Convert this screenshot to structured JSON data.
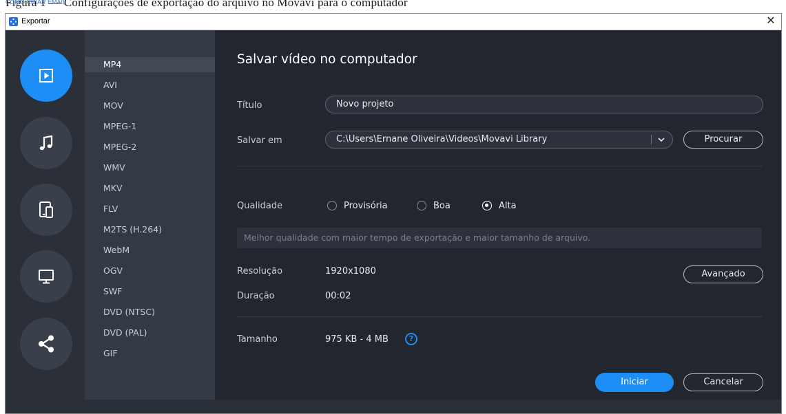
{
  "background": {
    "doc_text": "Figura 1 — Configurações de exportação do arquivo no Movavi para o computador",
    "link_text": "COMO CRIAR EMAIL"
  },
  "window": {
    "title": "Exportar",
    "close_glyph": "✕"
  },
  "colors": {
    "accent": "#1e8ef7",
    "window_bg": "#2a2f38",
    "panel_bg": "#22262e"
  },
  "rail": [
    {
      "id": "video",
      "icon": "play-icon",
      "active": true
    },
    {
      "id": "audio",
      "icon": "music-note-icon",
      "active": false
    },
    {
      "id": "devices",
      "icon": "devices-icon",
      "active": false
    },
    {
      "id": "tv",
      "icon": "monitor-icon",
      "active": false
    },
    {
      "id": "share",
      "icon": "share-icon",
      "active": false
    }
  ],
  "formats": {
    "selected": "MP4",
    "items": [
      "MP4",
      "AVI",
      "MOV",
      "MPEG-1",
      "MPEG-2",
      "WMV",
      "MKV",
      "FLV",
      "M2TS (H.264)",
      "WebM",
      "OGV",
      "SWF",
      "DVD (NTSC)",
      "DVD (PAL)",
      "GIF"
    ]
  },
  "main": {
    "heading": "Salvar vídeo no computador",
    "title_label": "Título",
    "title_value": "Novo projeto",
    "save_label": "Salvar em",
    "save_path": "C:\\Users\\Ernane Oliveira\\Videos\\Movavi Library",
    "browse_button": "Procurar",
    "quality_label": "Qualidade",
    "quality_options": [
      {
        "label": "Provisória",
        "checked": false
      },
      {
        "label": "Boa",
        "checked": false
      },
      {
        "label": "Alta",
        "checked": true
      }
    ],
    "quality_hint": "Melhor qualidade com maior tempo de exportação e maior tamanho de arquivo.",
    "resolution_label": "Resolução",
    "resolution_value": "1920x1080",
    "advanced_button": "Avançado",
    "duration_label": "Duração",
    "duration_value": "00:02",
    "size_label": "Tamanho",
    "size_value": "975 KB - 4 MB",
    "help_glyph": "?",
    "start_button": "Iniciar",
    "cancel_button": "Cancelar"
  }
}
